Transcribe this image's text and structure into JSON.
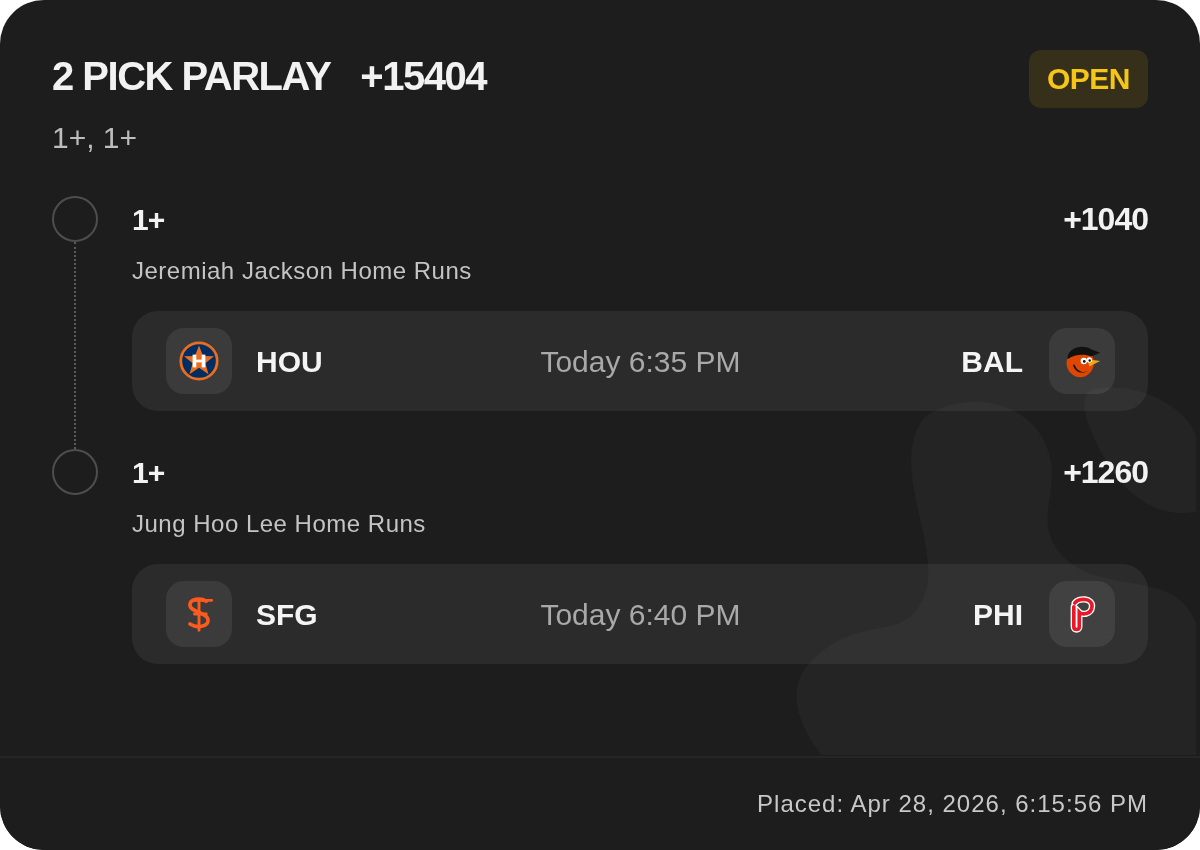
{
  "bet": {
    "title": "2 PICK PARLAY",
    "odds": "+15404",
    "summary": "1+, 1+",
    "status": "OPEN"
  },
  "legs": [
    {
      "line": "1+",
      "odds": "+1040",
      "market": "Jeremiah Jackson Home Runs",
      "game": {
        "left": {
          "abbr": "HOU",
          "kind": "star"
        },
        "time": "Today 6:35 PM",
        "right": {
          "abbr": "BAL",
          "kind": "bird"
        }
      }
    },
    {
      "line": "1+",
      "odds": "+1260",
      "market": "Jung Hoo Lee Home Runs",
      "game": {
        "left": {
          "abbr": "SFG",
          "kind": "swirl"
        },
        "time": "Today 6:40 PM",
        "right": {
          "abbr": "PHI",
          "kind": "loop"
        }
      }
    }
  ],
  "footer": {
    "placed": "Placed: Apr 28, 2026, 6:15:56 PM"
  }
}
